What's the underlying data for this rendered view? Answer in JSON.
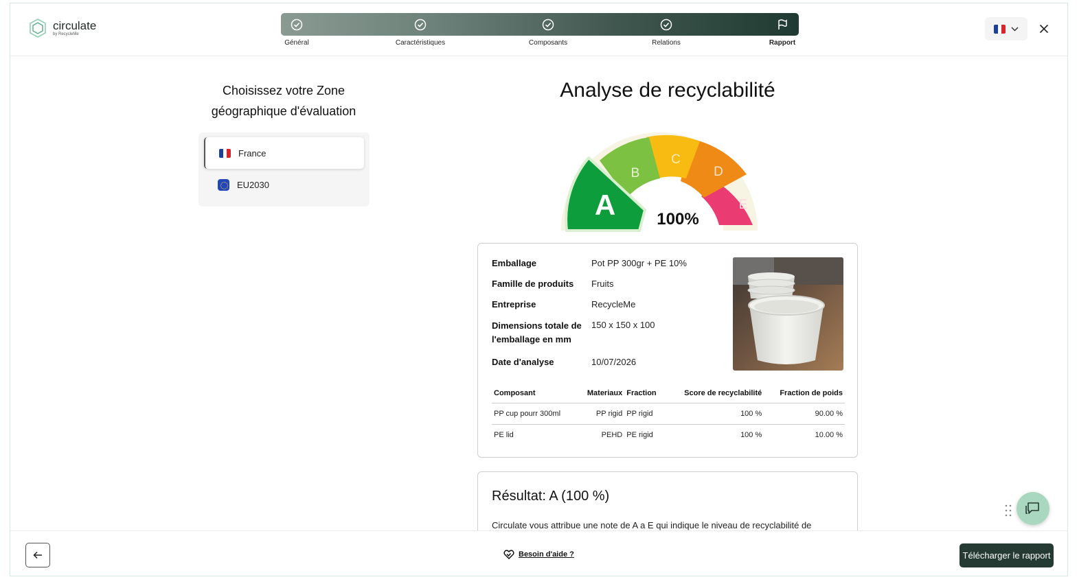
{
  "brand": {
    "name": "circulate",
    "tagline": "by RecycleMe",
    "accent": "#253a33"
  },
  "stepper": {
    "steps": [
      {
        "label": "Général",
        "icon": "check-circle-icon",
        "state": "done"
      },
      {
        "label": "Caractéristiques",
        "icon": "check-circle-icon",
        "state": "done"
      },
      {
        "label": "Composants",
        "icon": "check-circle-icon",
        "state": "done"
      },
      {
        "label": "Relations",
        "icon": "check-circle-icon",
        "state": "done"
      },
      {
        "label": "Rapport",
        "icon": "flag-icon",
        "state": "active"
      }
    ]
  },
  "header": {
    "language": "FR",
    "language_icon": "france-flag-icon"
  },
  "zone": {
    "title_line1": "Choisissez votre Zone",
    "title_line2": "géographique d'évaluation",
    "options": [
      {
        "label": "France",
        "icon": "france-flag-icon",
        "selected": true
      },
      {
        "label": "EU2030",
        "icon": "eu-flag-icon",
        "selected": false
      }
    ]
  },
  "analysis": {
    "title": "Analyse de recyclabilité",
    "gauge": {
      "grades": [
        "A",
        "B",
        "C",
        "D",
        "E"
      ],
      "colors": [
        "#0e9d3c",
        "#7dc143",
        "#f7bb12",
        "#f08a16",
        "#ea3c73"
      ],
      "selected_grade": "A",
      "percent_label": "100%"
    }
  },
  "packaging": {
    "fields": [
      {
        "key": "Emballage",
        "value": "Pot PP 300gr + PE 10%"
      },
      {
        "key": "Famille de produits",
        "value": "Fruits"
      },
      {
        "key": "Entreprise",
        "value": "RecycleMe"
      },
      {
        "key": "Dimensions totale de l'emballage en mm",
        "value": "150 x 150 x 100"
      },
      {
        "key": "Date d'analyse",
        "value": "10/07/2026"
      }
    ],
    "table": {
      "headers": [
        "Composant",
        "Materiaux",
        "Fraction",
        "Score de recyclabilité",
        "Fraction de poids"
      ],
      "rows": [
        [
          "PP cup pourr 300ml",
          "PP rigid",
          "PP rigid",
          "100 %",
          "90.00 %"
        ],
        [
          "PE lid",
          "PEHD",
          "PE rigid",
          "100 %",
          "10.00 %"
        ]
      ]
    }
  },
  "result": {
    "title": "Résultat: A (100 %)",
    "text": "Circulate vous attribue une note de A a E qui indique le niveau de recyclabilité de"
  },
  "footer": {
    "help_label": "Besoin d'aide ?",
    "download_label": "Télécharger le rapport"
  }
}
